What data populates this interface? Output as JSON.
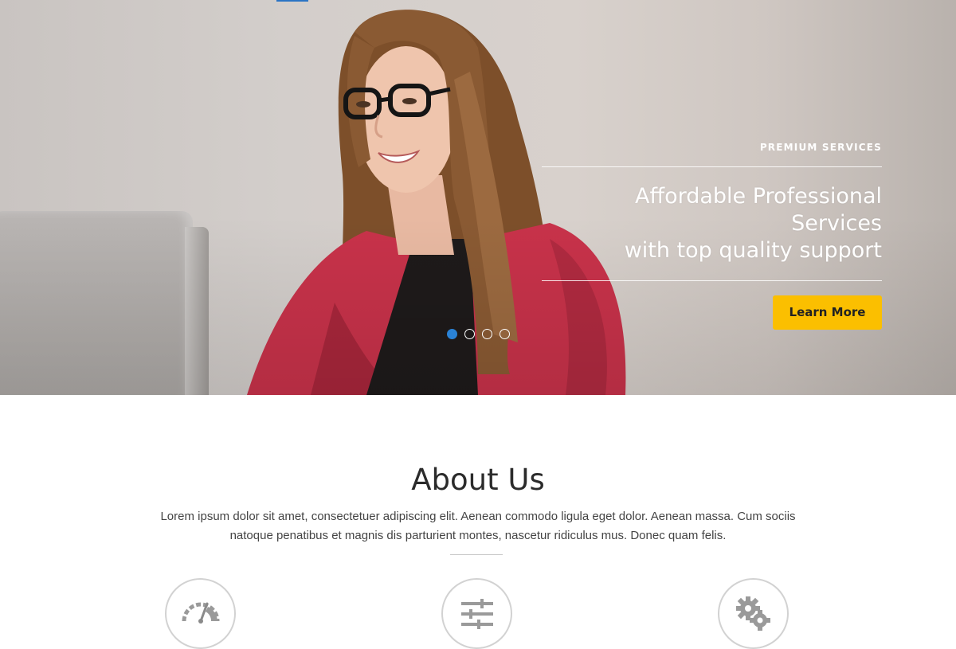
{
  "hero": {
    "eyebrow": "PREMIUM SERVICES",
    "headline_line1": "Affordable Professional Services",
    "headline_line2": "with top quality support",
    "cta_label": "Learn More",
    "slides": {
      "count": 4,
      "active_index": 0
    }
  },
  "about": {
    "title": "About Us",
    "text": "Lorem ipsum dolor sit amet, consectetuer adipiscing elit. Aenean commodo ligula eget dolor. Aenean massa. Cum sociis natoque penatibus et magnis dis parturient montes, nascetur ridiculus mus. Donec quam felis.",
    "features": [
      {
        "icon": "speedometer-icon"
      },
      {
        "icon": "sliders-icon"
      },
      {
        "icon": "gears-icon"
      }
    ]
  },
  "colors": {
    "cta": "#fbbf00",
    "dot_active": "#2a82d6",
    "jacket": "#c8324a",
    "hair": "#8a5a33"
  }
}
